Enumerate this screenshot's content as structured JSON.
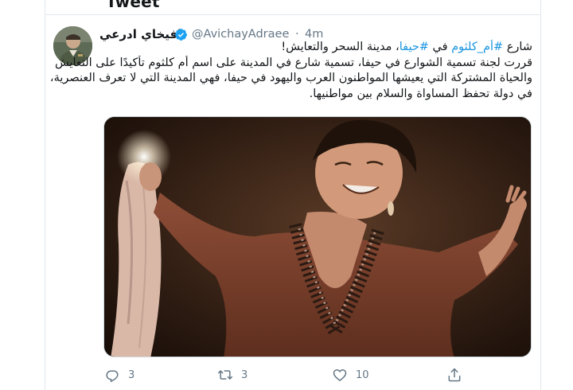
{
  "page": {
    "title": "Tweet"
  },
  "tweet": {
    "author": {
      "display_name": "افيخاي ادرعي",
      "handle": "@AvichayAdraee",
      "verified": true
    },
    "separator": "·",
    "time": "4m",
    "text": {
      "line1_pre": "شارع ",
      "line1_hashtag1": "#أم_كلثوم",
      "line1_mid": " في ",
      "line1_hashtag2": "#حيفا",
      "line1_post": "، مدينة السحر والتعايش!",
      "line2": "قررت لجنة تسمية الشوارع في حيفا، تسمية شارع في المدينة على اسم أم كلثوم تأكيدًا على التعايش",
      "line3": "والحياة المشتركة التي يعيشها المواطنون العرب واليهود في حيفا، فهي المدينة التي لا تعرف العنصرية،",
      "line4": "في دولة تحفظ المساواة والسلام بين مواطنيها."
    },
    "actions": {
      "replies": "3",
      "retweets": "3",
      "likes": "10"
    }
  },
  "colors": {
    "link": "#1b95e0",
    "muted": "#657786",
    "verified": "#1da1f2"
  },
  "icons": {
    "verified": "verified-badge-icon",
    "caret": "chevron-down-icon",
    "reply": "reply-icon",
    "retweet": "retweet-icon",
    "like": "heart-icon",
    "share": "share-icon"
  }
}
